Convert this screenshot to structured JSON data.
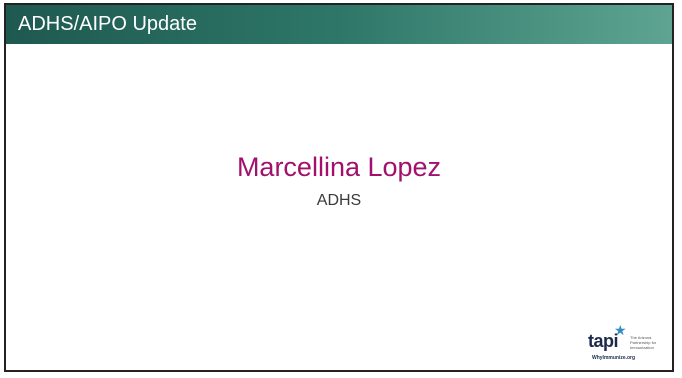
{
  "slide": {
    "title": "ADHS/AIPO Update",
    "presenter_name": "Marcellina Lopez",
    "presenter_org": "ADHS"
  },
  "logo": {
    "wordmark": "tapi",
    "tagline": "The Arizona Partnership for Immunization",
    "url": "WhyImmunize.org",
    "icon": "star-icon"
  },
  "colors": {
    "title_bar_dark": "#1e5950",
    "title_bar_light": "#5fa492",
    "presenter_name": "#a0106c",
    "border": "#222222"
  }
}
